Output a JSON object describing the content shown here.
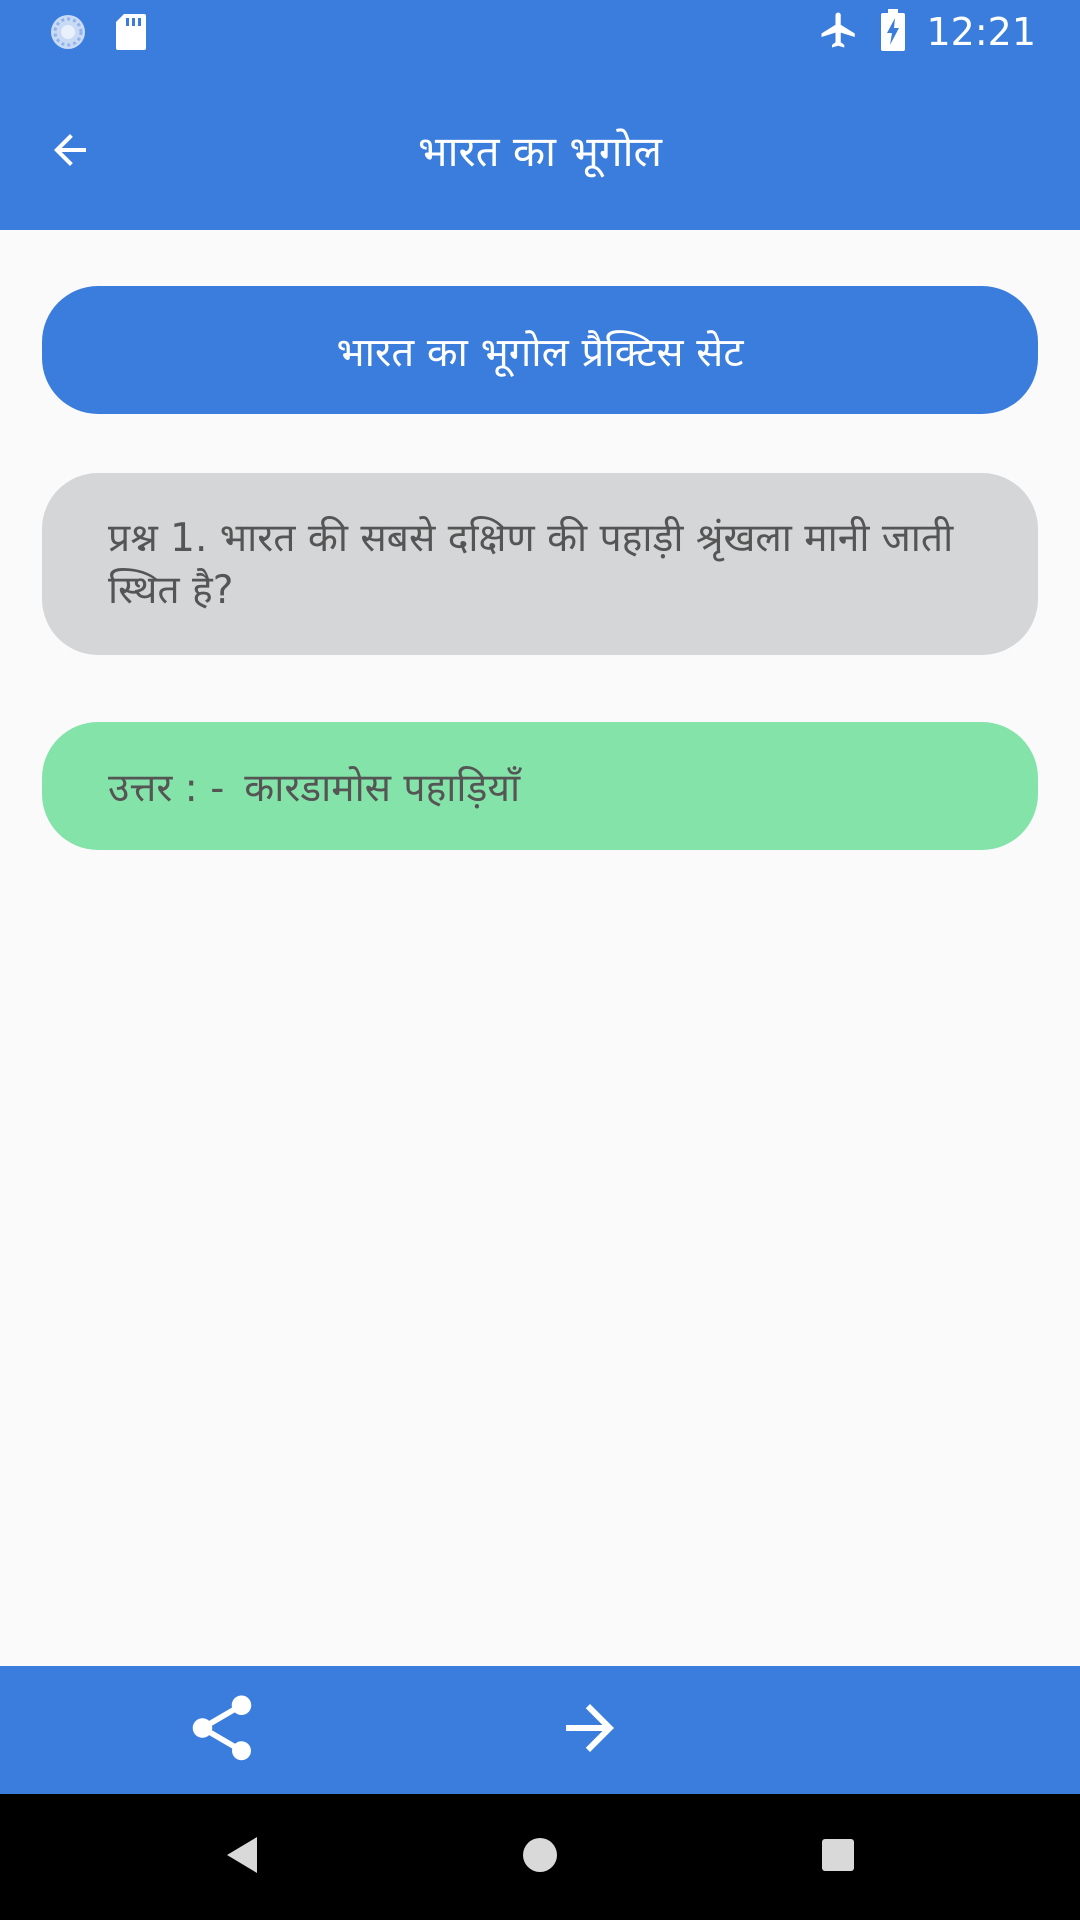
{
  "status_bar": {
    "time": "12:21",
    "icons": [
      "sync-icon",
      "sd-card-icon",
      "airplane-mode-icon",
      "battery-charging-icon"
    ]
  },
  "app_bar": {
    "title": "भारत का भूगोल",
    "back_icon": "arrow-left-icon"
  },
  "content": {
    "set_title": "भारत का भूगोल प्रैक्टिस सेट",
    "question": "प्रश्न 1. भारत की सबसे दक्षिण की पहाड़ी श्रृंखला मानी जाती स्थित है?",
    "answer_prefix": "उत्तर : -",
    "answer": "कारडामोस पहाड़ियाँ"
  },
  "bottom_bar": {
    "share_icon": "share-icon",
    "next_icon": "arrow-right-icon"
  },
  "nav_bar": {
    "icons": [
      "nav-back-icon",
      "nav-home-icon",
      "nav-recent-icon"
    ]
  },
  "colors": {
    "primary": "#3B7DDD",
    "question_bg": "#D5D6D7",
    "answer_bg": "#84E3A9",
    "page_bg": "#FAFAFA"
  }
}
